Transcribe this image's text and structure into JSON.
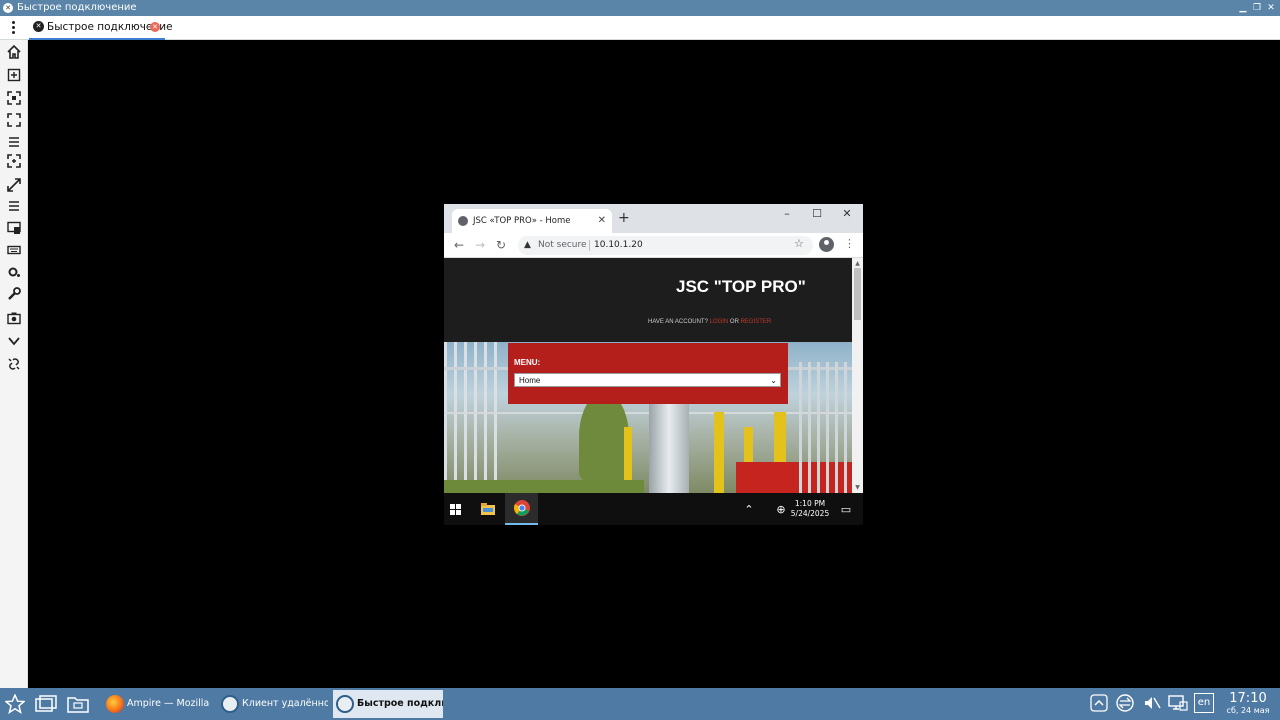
{
  "window": {
    "title": "Быстрое подключение"
  },
  "tabbar": {
    "tab_label": "Быстрое подключение"
  },
  "remote_browser": {
    "tab_title": "JSC «TOP PRO» - Home",
    "security_label": "Not secure",
    "url": "10.10.1.20",
    "page": {
      "site_title": "JSC \"TOP PRO\"",
      "account_prefix": "HAVE AN ACCOUNT?",
      "login_label": "LOGIN",
      "or_label": "OR",
      "register_label": "REGISTER",
      "menu_label": "MENU:",
      "menu_selected": "Home"
    }
  },
  "remote_taskbar": {
    "time": "1:10 PM",
    "date": "5/24/2025"
  },
  "host_taskbar": {
    "tasks": [
      {
        "label": "Ampire — Mozilla ..."
      },
      {
        "label": "Клиент удалённо..."
      },
      {
        "label": "Быстрое подклю..."
      }
    ],
    "lang": "en",
    "time": "17:10",
    "date": "сб, 24 мая"
  },
  "colors": {
    "accent": "#4f7aa3",
    "menu_red": "#b51f1b",
    "link_red": "#c0392b"
  }
}
